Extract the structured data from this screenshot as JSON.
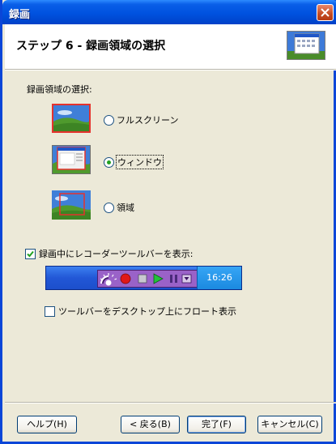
{
  "window": {
    "title": "録画"
  },
  "header": {
    "step_title": "ステップ 6 - 録画領域の選択"
  },
  "section": {
    "label": "録画領域の選択:"
  },
  "options": [
    {
      "label": "フルスクリーン",
      "selected": false,
      "thumb": "fullscreen-thumbnail"
    },
    {
      "label": "ウィンドウ",
      "selected": true,
      "thumb": "window-thumbnail"
    },
    {
      "label": "領域",
      "selected": false,
      "thumb": "region-thumbnail"
    }
  ],
  "show_toolbar": {
    "label": "録画中にレコーダーツールバーを表示:",
    "checked": true
  },
  "toolbar_preview": {
    "clock": "16:26"
  },
  "float_toolbar": {
    "label": "ツールバーをデスクトップ上にフロート表示",
    "checked": false
  },
  "buttons": {
    "help": "ヘルプ(H)",
    "back": "< 戻る(B)",
    "finish": "完了(F)",
    "cancel": "キャンセル(C)"
  },
  "colors": {
    "title_bar": "#0052df",
    "close_button": "#c44b22",
    "selection_border": "#e5322d",
    "toolbar": "#2257d6",
    "recorder_strip": "#9a62c8"
  }
}
